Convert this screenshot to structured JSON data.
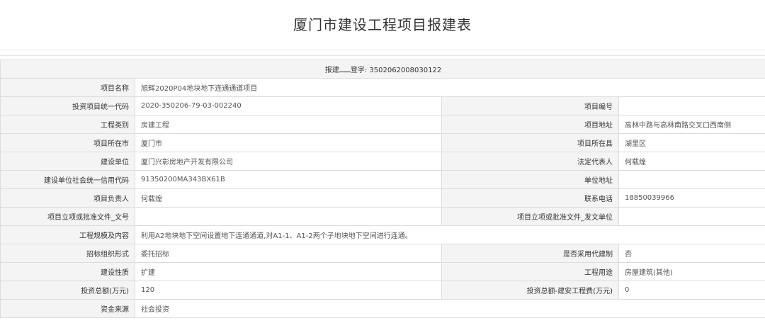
{
  "title": "厦门市建设工程项目报建表",
  "registration": {
    "prefix": "报建",
    "suffix": "登字:",
    "number": "3502062008030122"
  },
  "rows": [
    {
      "label": "项目名称",
      "value": "旭辉2020P04地块地下连通通道项目"
    },
    {
      "label": "投资项目统一代码",
      "value": "2020-350206-79-03-002240",
      "label2": "项目编号",
      "value2": ""
    },
    {
      "label": "工程类别",
      "value": "房建工程",
      "label2": "项目地址",
      "value2": "高林中路与高林南路交叉口西南侧"
    },
    {
      "label": "项目所在市",
      "value": "厦门市",
      "label2": "项目所在县",
      "value2": "湖里区"
    },
    {
      "label": "建设单位",
      "value": "厦门兴彰房地产开发有限公司",
      "label2": "法定代表人",
      "value2": "何载煌"
    },
    {
      "label": "建设单位社会统一信用代码",
      "value": "91350200MA343BX61B",
      "label2": "单位地址",
      "value2": ""
    },
    {
      "label": "项目负责人",
      "value": "何载煌",
      "label2": "联系电话",
      "value2": "18850039966"
    },
    {
      "label": "项目立项或批准文件_文号",
      "value": "",
      "label2": "项目立项或批准文件_发文单位",
      "value2": ""
    },
    {
      "label": "工程规模及内容",
      "value": "利用A2地块地下空间设置地下连通通道,对A1-1、A1-2两个子地块地下空间进行连通。"
    },
    {
      "label": "招标组织形式",
      "value": "委托招标",
      "label2": "是否采用代建制",
      "value2": "否"
    },
    {
      "label": "建设性质",
      "value": "扩建",
      "label2": "工程用途",
      "value2": "房屋建筑(其他)"
    },
    {
      "label": "投资总额(万元)",
      "value": "120",
      "label2": "投资总额-建安工程费(万元)",
      "value2": "0"
    },
    {
      "label": "资金来源",
      "value": "社会投资"
    }
  ]
}
